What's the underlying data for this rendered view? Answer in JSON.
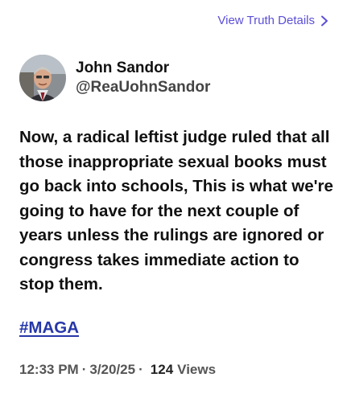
{
  "header": {
    "details_link": "View Truth Details"
  },
  "author": {
    "name": "John Sandor",
    "handle": "@ReaUohnSandor"
  },
  "post": {
    "text": "Now, a radical leftist judge ruled that all those inappropriate sexual books must go back into schools, This is what we're going to have for the next couple of years unless the rulings are ignored or congress takes immediate action to stop them.",
    "hashtag": "#MAGA"
  },
  "meta": {
    "time": "12:33 PM",
    "date": "3/20/25",
    "separator": "·",
    "views_count": "124",
    "views_label": "Views"
  },
  "colors": {
    "link": "#5b4fd6",
    "hashtag": "#2637a8"
  }
}
